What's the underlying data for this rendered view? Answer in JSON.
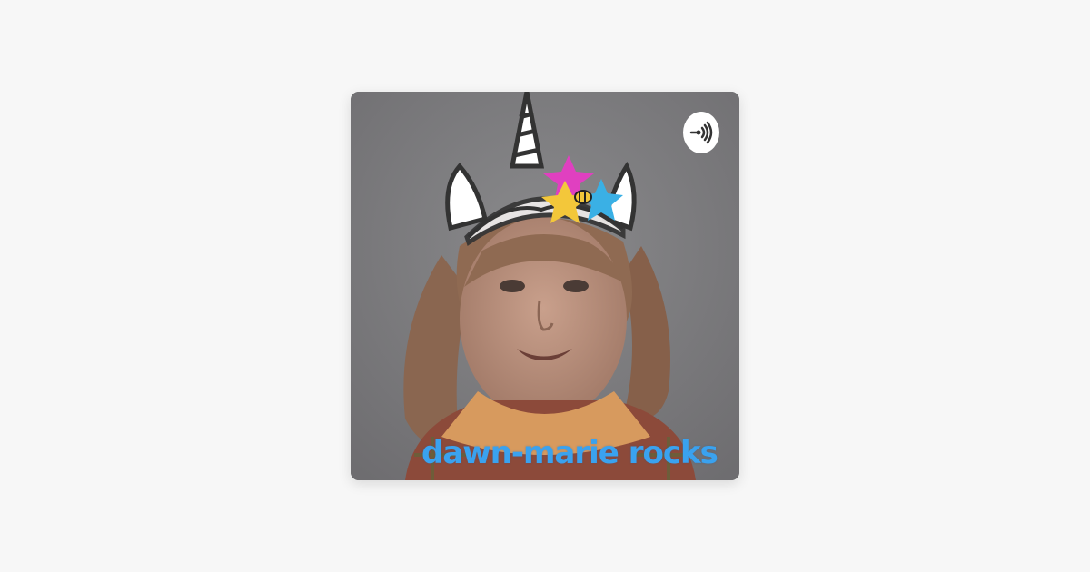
{
  "artwork": {
    "caption": "dawn-marie rocks",
    "icons": {
      "badge": "anchor-podcast-icon",
      "horn": "unicorn-horn-icon",
      "stars": [
        "pink-star",
        "yellow-star",
        "blue-star"
      ],
      "bee": "bee-icon"
    }
  },
  "colors": {
    "page_background": "#f7f7f7",
    "caption_color": "#3aa2ef",
    "badge_background": "#ffffff"
  }
}
